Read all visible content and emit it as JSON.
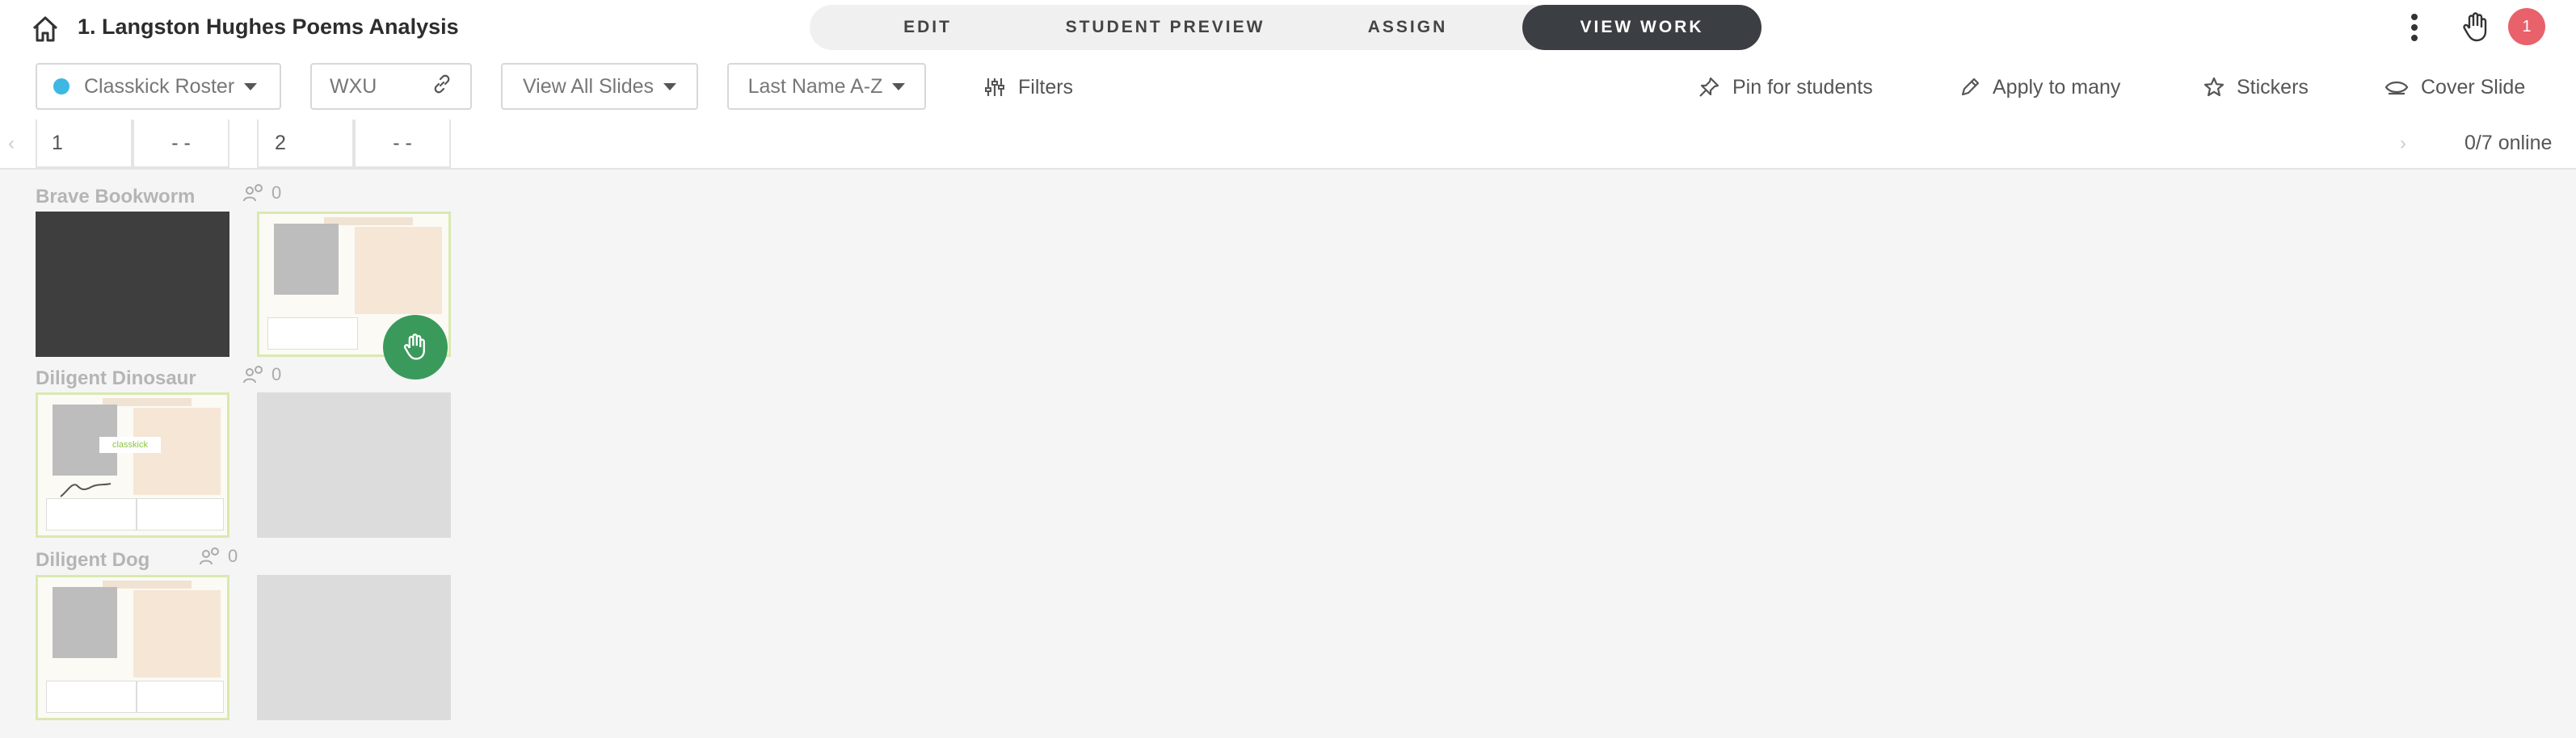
{
  "header": {
    "lesson_title": "1. Langston Hughes Poems Analysis",
    "tabs": [
      {
        "label": "EDIT"
      },
      {
        "label": "STUDENT PREVIEW"
      },
      {
        "label": "ASSIGN"
      },
      {
        "label": "VIEW WORK",
        "active": true
      }
    ],
    "notification_count": "1"
  },
  "toolbar": {
    "roster_label": "Classkick Roster",
    "class_code": "WXU",
    "slides_filter": "View All Slides",
    "sort": "Last Name A-Z",
    "filters_label": "Filters",
    "pin_label": "Pin for students",
    "apply_label": "Apply to many",
    "stickers_label": "Stickers",
    "cover_label": "Cover Slide"
  },
  "slide_row": {
    "slides": [
      {
        "number": "1",
        "score": "- -"
      },
      {
        "number": "2",
        "score": "- -"
      }
    ],
    "online_status": "0/7 online"
  },
  "students": [
    {
      "name": "Brave Bookworm",
      "help_count": "0",
      "thumbs": [
        "dark",
        "slide"
      ]
    },
    {
      "name": "Diligent Dinosaur",
      "help_count": "0",
      "thumbs": [
        "slide",
        "empty"
      ]
    },
    {
      "name": "Diligent Dog",
      "help_count": "0",
      "thumbs": [
        "slide",
        "empty"
      ]
    }
  ],
  "slide_thumb_logo": "classkick",
  "colors": {
    "active_tab": "#3b3e42",
    "badge": "#e8616b",
    "roster_dot": "#3db7e4",
    "hand_button": "#3a9a5b"
  }
}
